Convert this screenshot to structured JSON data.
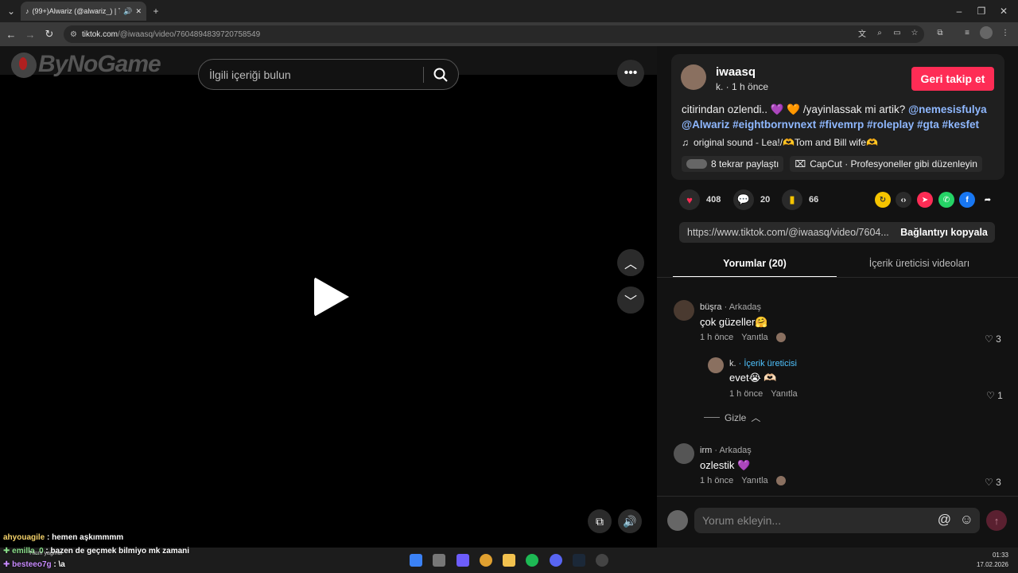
{
  "browser": {
    "tab_title": "(99+)Alwariz (@alwariz_) | T",
    "url_host": "tiktok.com",
    "url_path": "/@iwaasq/video/7604894839720758549"
  },
  "video": {
    "logo_text": "ByNoGame",
    "search_placeholder": "İlgili içeriği bulun"
  },
  "post": {
    "username": "iwaasq",
    "meta": "k. · 1 h önce",
    "follow_label": "Geri takip et",
    "description_plain": "citirindan ozlendi.. 💜 🧡 /yayinlassak mi artik? ",
    "description_tags_line1": "@nemesisfulya",
    "description_tags_line2": "@Alwariz #eightbornvnext #fivemrp #roleplay #gta #kesfet",
    "music": "original sound - Lea!/🫶Tom and Bill wife🫶",
    "reposts": "8 tekrar paylaştı",
    "capcut": "CapCut · Profesyoneller gibi düzenleyin",
    "likes": "408",
    "comments": "20",
    "saves": "66",
    "link": "https://www.tiktok.com/@iwaasq/video/7604...",
    "copy_label": "Bağlantıyı kopyala"
  },
  "tabs": {
    "comments": "Yorumlar (20)",
    "creator_videos": "İçerik üreticisi videoları"
  },
  "comments": [
    {
      "name": "büşra",
      "tag": " · Arkadaş",
      "text": "çok güzeller🤗",
      "time": "1 h önce",
      "reply": "Yanıtla",
      "likes": "3"
    },
    {
      "name": "k.",
      "tag": " · İçerik üreticisi",
      "text": "evet😭 🫶🏻",
      "time": "1 h önce",
      "reply": "Yanıtla",
      "likes": "1"
    },
    {
      "name": "irm",
      "tag": " · Arkadaş",
      "text": "ozlestik 💜",
      "time": "1 h önce",
      "reply": "Yanıtla",
      "likes": "3"
    }
  ],
  "hide_label": "Gizle",
  "comment_placeholder": "Yorum ekleyin...",
  "chat": [
    {
      "user": "ahyouagile",
      "msg": " : hemen aşkımmmm",
      "color": "#f5d36b"
    },
    {
      "user": "emilla_0",
      "msg": " : bazen de geçmek bilmiyo mk zamani",
      "color": "#8be08b"
    },
    {
      "user": "besteeo7g",
      "msg": " : \\a",
      "color": "#c98bff"
    }
  ],
  "taskbar": {
    "weather": "Tıkım yağmur",
    "time": "01:33",
    "date": "17.02.2026"
  }
}
